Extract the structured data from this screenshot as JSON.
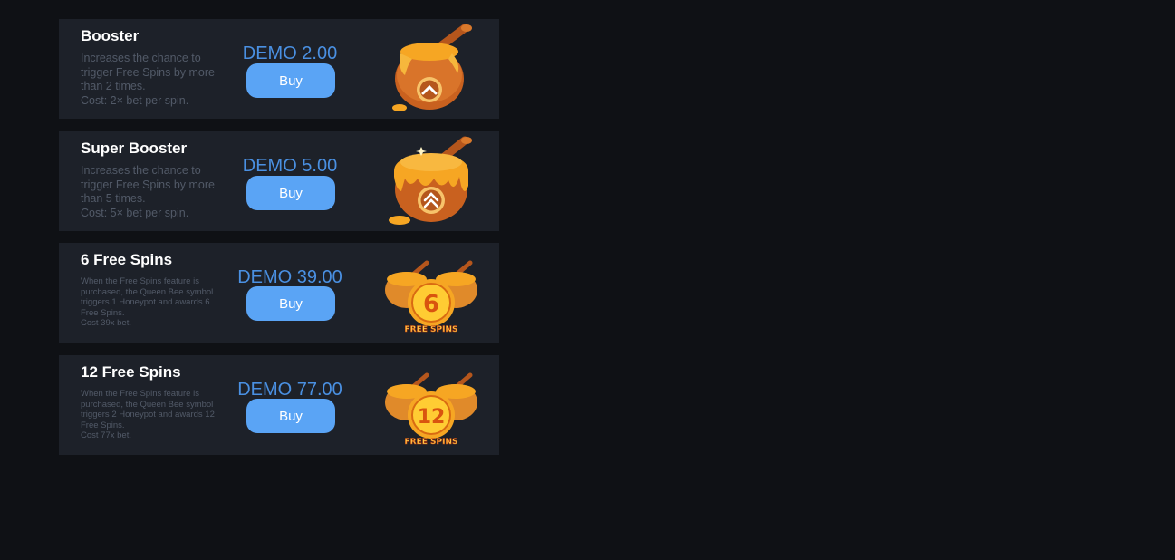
{
  "features": [
    {
      "title": "Booster",
      "description": [
        "Increases the chance to",
        "trigger Free Spins by more",
        "than 2 times.",
        "Cost: 2× bet per spin."
      ],
      "price": "DEMO 2.00",
      "buy_label": "Buy",
      "icon": "honey-pot-up-arrow-icon"
    },
    {
      "title": "Super Booster",
      "description": [
        "Increases the chance to",
        "trigger Free Spins by more",
        "than 5 times.",
        "Cost: 5× bet per spin."
      ],
      "price": "DEMO 5.00",
      "buy_label": "Buy",
      "icon": "honey-pot-double-arrow-icon"
    },
    {
      "title": "6 Free Spins",
      "description": [
        "When the Free Spins feature is",
        "purchased, the Queen Bee symbol",
        "triggers 1 Honeypot and awards 6",
        "Free Spins.",
        "Cost 39x bet."
      ],
      "price": "DEMO 39.00",
      "buy_label": "Buy",
      "icon": "free-spins-6-coin-icon",
      "badge_number": "6",
      "badge_text": "FREE SPINS"
    },
    {
      "title": "12 Free Spins",
      "description": [
        "When the Free Spins feature is",
        "purchased, the Queen Bee symbol",
        "triggers 2 Honeypot and awards 12",
        "Free Spins.",
        "Cost 77x bet."
      ],
      "price": "DEMO 77.00",
      "buy_label": "Buy",
      "icon": "free-spins-12-coin-icon",
      "badge_number": "12",
      "badge_text": "FREE SPINS"
    }
  ],
  "colors": {
    "background": "#0f1115",
    "panel": "#1d2129",
    "price": "#4a90e2",
    "button": "#5aa4f5",
    "honey": "#f5a623"
  }
}
